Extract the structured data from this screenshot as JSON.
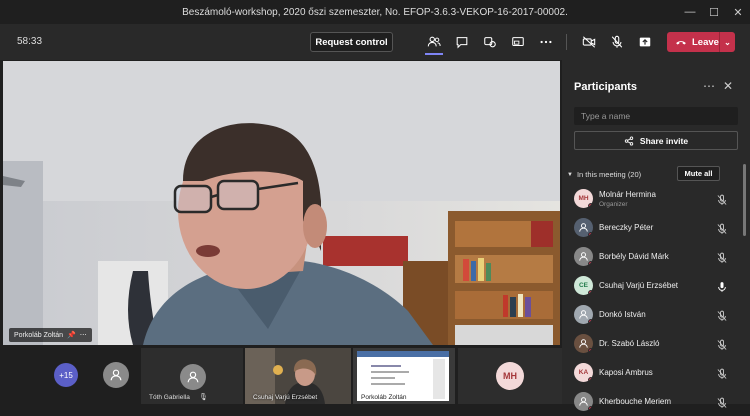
{
  "window": {
    "title": "Beszámoló-workshop, 2020 őszi szemeszter, No. EFOP-3.6.3-VEKOP-16-2017-00002."
  },
  "toolbar": {
    "timer": "58:33",
    "request_control": "Request control",
    "leave_label": "Leave"
  },
  "video": {
    "speaker_name": "Porkoláb Zoltán"
  },
  "strip": {
    "overflow_count": "+15",
    "tiles": [
      {
        "name": "Tóth Gabriella"
      },
      {
        "name": "Csuhaj Varjú Erzsébet"
      },
      {
        "name": "Porkoláb Zoltán"
      },
      {
        "initials": "MH"
      }
    ]
  },
  "participants": {
    "title": "Participants",
    "search_placeholder": "Type a name",
    "share_invite": "Share invite",
    "section_label": "In this meeting (20)",
    "mute_all": "Mute all",
    "people": [
      {
        "name": "Molnár Hermina",
        "role": "Organizer",
        "initials": "MH",
        "avatar_color": "#f3d9d9",
        "mic": "muted"
      },
      {
        "name": "Bereczky Péter",
        "role": "",
        "initials": "",
        "avatar_color": "#556070",
        "mic": "muted"
      },
      {
        "name": "Borbély Dávid Márk",
        "role": "",
        "initials": "",
        "avatar_color": "#888888",
        "mic": "muted"
      },
      {
        "name": "Csuhaj Varjú Erzsébet",
        "role": "",
        "initials": "CE",
        "avatar_color": "#cfe8d8",
        "mic": "on"
      },
      {
        "name": "Donkó István",
        "role": "",
        "initials": "",
        "avatar_color": "#a0a8b0",
        "mic": "muted"
      },
      {
        "name": "Dr. Szabó László",
        "role": "",
        "initials": "",
        "avatar_color": "#6a5040",
        "mic": "muted"
      },
      {
        "name": "Kaposi Ambrus",
        "role": "",
        "initials": "KA",
        "avatar_color": "#f3d9d9",
        "mic": "muted"
      },
      {
        "name": "Kherbouche Meriem",
        "role": "",
        "initials": "",
        "avatar_color": "#888888",
        "mic": "muted"
      }
    ]
  },
  "colors": {
    "leave": "#c4314b",
    "accent": "#6264a7",
    "panel_bg": "#292929"
  }
}
